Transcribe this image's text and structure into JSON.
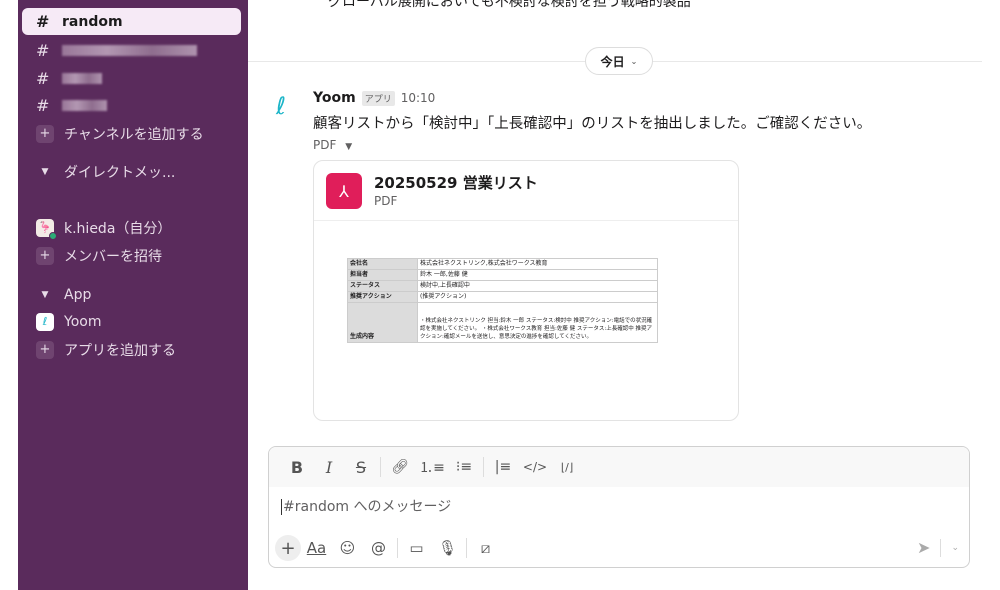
{
  "sidebar": {
    "active_channel": "random",
    "add_channel": "チャンネルを追加する",
    "dm_section": "ダイレクトメッ...",
    "self_user": "k.hieda（自分）",
    "invite": "メンバーを招待",
    "app_section": "App",
    "app_yoom": "Yoom",
    "add_app": "アプリを追加する"
  },
  "main": {
    "prev_message_clipped": "グローバル展開においても不検討な検討を担う戦略的製品",
    "date_pill": "今日",
    "message": {
      "sender": "Yoom",
      "badge": "アプリ",
      "time": "10:10",
      "text": "顧客リストから「検討中」「上長確認中」のリストを抽出しました。ご確認ください。",
      "attachment_label": "PDF",
      "file": {
        "title": "20250529 営業リスト",
        "type": "PDF",
        "preview": [
          [
            "会社名",
            "株式会社ネクストリンク,株式会社ワークス教育"
          ],
          [
            "担当者",
            "鈴木 一郎,佐藤 健"
          ],
          [
            "ステータス",
            "検討中,上長確認中"
          ],
          [
            "推奨アクション",
            "(推奨アクション)"
          ],
          [
            "生成内容",
            "・株式会社ネクストリンク 担当:鈴木 一郎 ステータス:検討中 推奨アクション:電話での状況確認を実施してください。 ・株式会社ワークス教育 担当:佐藤 健 ステータス:上長確認中 推奨アクション:確認メールを送信し、意思決定の進捗を確認してください。"
          ]
        ]
      }
    }
  },
  "composer": {
    "placeholder": "#random へのメッセージ",
    "aa": "Aa"
  },
  "colors": {
    "sidebar": "#5a2b5c",
    "pdf": "#e01e5a",
    "accent": "#1cb5c8"
  }
}
